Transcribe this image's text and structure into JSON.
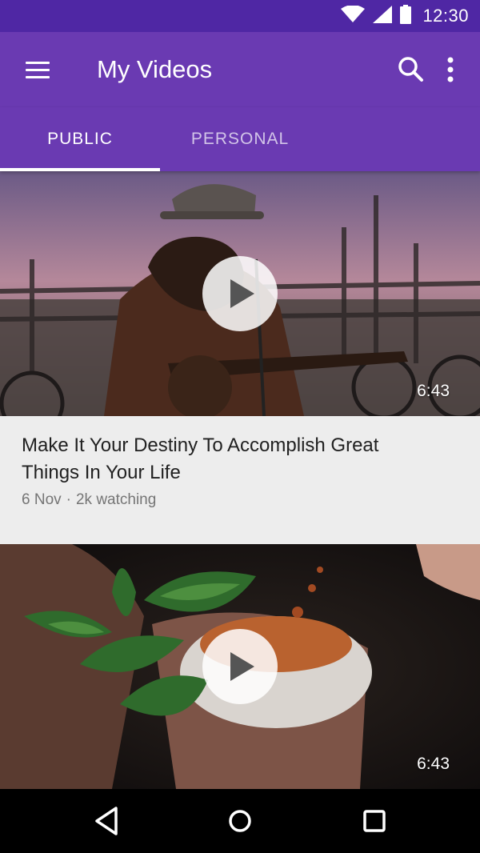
{
  "status_bar": {
    "time": "12:30",
    "icons": [
      "wifi-icon",
      "signal-icon",
      "battery-icon"
    ]
  },
  "app_bar": {
    "title": "My Videos",
    "icons": [
      "menu-icon",
      "search-icon",
      "more-vert-icon"
    ]
  },
  "tabs": [
    {
      "label": "PUBLIC",
      "selected": true
    },
    {
      "label": "PERSONAL",
      "selected": false
    }
  ],
  "videos": [
    {
      "title": "Make It Your Destiny To Accomplish Great Things In Your Life",
      "date": "6 Nov",
      "separator": "·",
      "viewers": "2k watching",
      "duration": "6:43"
    },
    {
      "title": "",
      "duration": "6:43"
    }
  ],
  "nav_bar": {
    "icons": [
      "back-icon",
      "home-icon",
      "recents-icon"
    ]
  },
  "colors": {
    "status_bar": "#4f27a4",
    "app_bar": "#6a3ab2",
    "card_background": "#ededed"
  }
}
